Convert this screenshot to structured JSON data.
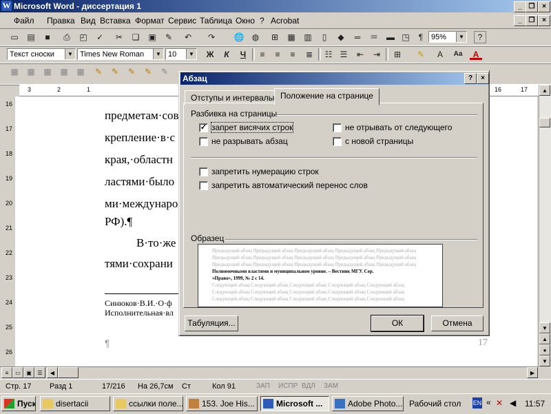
{
  "window": {
    "title": "Microsoft Word - диссертация 1"
  },
  "menu": [
    "Файл",
    "Правка",
    "Вид",
    "Вставка",
    "Формат",
    "Сервис",
    "Таблица",
    "Окно",
    "?",
    "Acrobat"
  ],
  "toolbar": {
    "zoom": "95%",
    "style": "Текст сноски",
    "font": "Times New Roman",
    "size": "10"
  },
  "ruler": {
    "marks": [
      "3",
      "2",
      "1",
      "16",
      "17"
    ]
  },
  "vruler": {
    "marks": [
      "16",
      "17",
      "18",
      "19",
      "20",
      "21",
      "22",
      "23",
      "24",
      "25",
      "26"
    ]
  },
  "document": {
    "lines": [
      "предметам·сов",
      "крепление·в·с",
      "края,·областн",
      "ластями·было",
      "ми·междунаро",
      "РФ).¶",
      "В·то·же",
      "тями·сохрани"
    ],
    "footnote1": "Синюков·В.И.·О·ф",
    "footnote2": "Исполнительная·вл",
    "para_mark": "¶",
    "page_num": "17"
  },
  "dialog": {
    "title": "Абзац",
    "help": "?",
    "close": "×",
    "tabs": [
      "Отступы и интервалы",
      "Положение на странице"
    ],
    "group_pagination": "Разбивка на страницы",
    "cb_widow": "запрет висячих строк",
    "cb_keep_together": "не разрывать абзац",
    "cb_keep_next": "не отрывать от следующего",
    "cb_page_break": "с новой страницы",
    "cb_suppress_numbers": "запретить нумерацию строк",
    "cb_no_hyphen": "запретить автоматический перенос слов",
    "group_preview": "Образец",
    "preview_prev": "Предыдущий абзац Предыдущий абзац Предыдущий абзац Предыдущий абзац Предыдущий абзац",
    "preview_main1": "Полномочными властями и муниципальном уровне. – Вестник МГУ. Сер.",
    "preview_main2": "«Право», 1999, № 2 с 14.",
    "preview_next": "Следующий абзац Следующий абзац Следующий абзац Следующий абзац Следующий абзац",
    "btn_tabs": "Табуляция...",
    "btn_ok": "ОК",
    "btn_cancel": "Отмена"
  },
  "status": {
    "page": "Стр. 17",
    "section": "Разд 1",
    "pages": "17/216",
    "at": "На 26,7см",
    "line": "Ст",
    "col": "Кол 91",
    "rec": "ЗАП",
    "trk": "ИСПР",
    "ext": "ВДЛ",
    "ovr": "ЗАМ"
  },
  "taskbar": {
    "start": "Пуск",
    "tasks": [
      "disertacii",
      "ссылки поле...",
      "153. Joe His...",
      "Microsoft ...",
      "Adobe Photo..."
    ],
    "desktop": "Рабочий стол",
    "lang": "EN",
    "clock": "11:57"
  }
}
